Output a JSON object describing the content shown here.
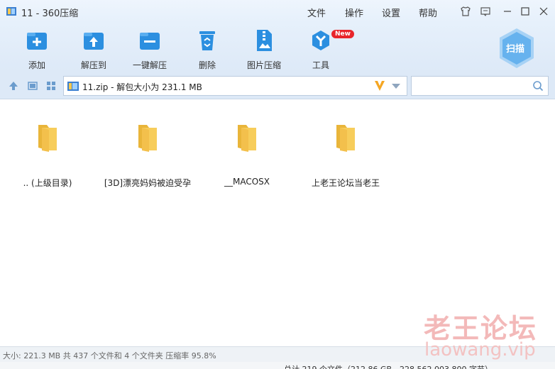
{
  "window": {
    "title": "11 - 360压缩",
    "menu": [
      "文件",
      "操作",
      "设置",
      "帮助"
    ]
  },
  "toolbar": {
    "tools": [
      {
        "label": "添加",
        "icon": "add-icon"
      },
      {
        "label": "解压到",
        "icon": "extract-to-icon"
      },
      {
        "label": "一键解压",
        "icon": "one-click-extract-icon"
      },
      {
        "label": "删除",
        "icon": "delete-icon"
      },
      {
        "label": "图片压缩",
        "icon": "image-compress-icon"
      },
      {
        "label": "工具",
        "icon": "tools-icon"
      }
    ],
    "new_badge": "New",
    "scan_label": "扫描"
  },
  "address": {
    "path": "11.zip - 解包大小为 231.1 MB",
    "search_placeholder": ""
  },
  "files": [
    {
      "name": ".. (上级目录)"
    },
    {
      "name": "[3D]漂亮妈妈被迫受孕"
    },
    {
      "name": "__MACOSX"
    },
    {
      "name": "上老王论坛当老王"
    }
  ],
  "status": {
    "text": "大小: 221.3 MB 共 437 个文件和 4 个文件夹 压缩率 95.8%"
  },
  "behind_window": {
    "text": "总计 219 个文件（212.86 GB，228,562,003,800 字节）"
  },
  "watermark": {
    "line1": "老王论坛",
    "line2": "laowang.vip"
  },
  "colors": {
    "accent": "#2c8fe0",
    "toolbar_bg": "#e1ecf8",
    "folder": "#f5c850",
    "badge": "#e8252b"
  }
}
